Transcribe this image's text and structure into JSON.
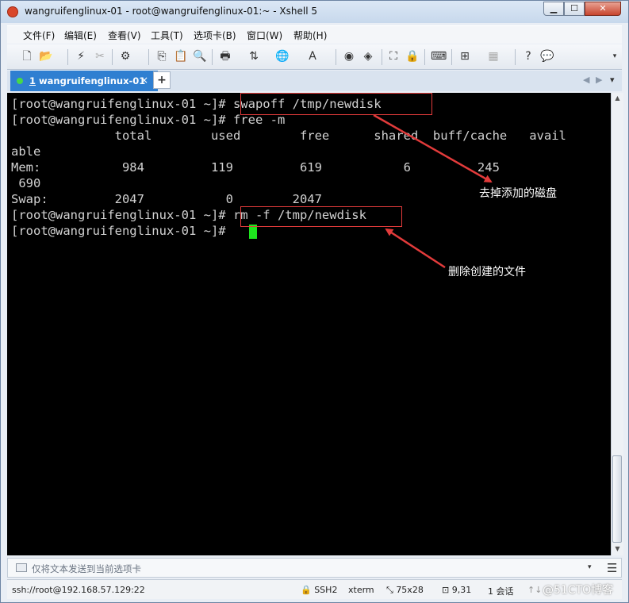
{
  "window": {
    "title": "wangruifenglinux-01 - root@wangruifenglinux-01:~ - Xshell 5",
    "minimize": "▁",
    "maximize": "☐",
    "close": "✕"
  },
  "menu": {
    "items": [
      "文件(F)",
      "编辑(E)",
      "查看(V)",
      "工具(T)",
      "选项卡(B)",
      "窗口(W)",
      "帮助(H)"
    ]
  },
  "tabs": {
    "active": {
      "number": "1",
      "label": "wangruifenglinux-01",
      "close": "×"
    },
    "add": "+",
    "nav_prev": "◀",
    "nav_next": "▶",
    "menu": "▾"
  },
  "terminal": {
    "lines": [
      "[root@wangruifenglinux-01 ~]# swapoff /tmp/newdisk",
      "[root@wangruifenglinux-01 ~]# free -m",
      "              total        used        free      shared  buff/cache   avail",
      "able",
      "Mem:           984         119         619           6         245",
      " 690",
      "Swap:         2047           0        2047",
      "[root@wangruifenglinux-01 ~]# rm -f /tmp/newdisk",
      "[root@wangruifenglinux-01 ~]# "
    ]
  },
  "annotations": {
    "note1": "去掉添加的磁盘",
    "note2": "删除创建的文件",
    "color": "#e23b3b"
  },
  "sendbar": {
    "placeholder": "仅将文本发送到当前选项卡",
    "dropdown": "▾",
    "menu": "☰"
  },
  "status": {
    "connection": "ssh://root@192.168.57.129:22",
    "protocol": "SSH2",
    "terminal_type": "xterm",
    "size": "75x28",
    "cursor_pos": "9,31",
    "sessions": "1 会话"
  },
  "watermark": "@51CTO博客",
  "colors": {
    "tab_active": "#2f7fd1",
    "cursor": "#1ee61e",
    "terminal_bg": "#000000"
  }
}
